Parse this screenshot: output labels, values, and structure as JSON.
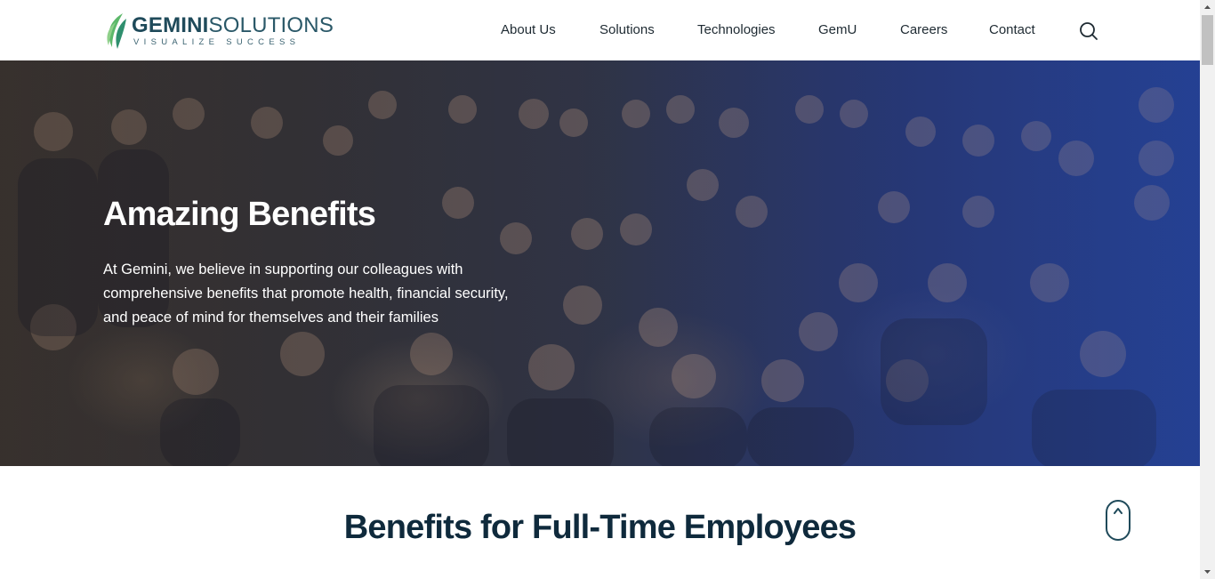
{
  "header": {
    "logo": {
      "brand_bold": "GEMINI",
      "brand_light": "SOLUTIONS",
      "tagline": "VISUALIZE SUCCESS"
    },
    "nav": [
      {
        "label": "About Us"
      },
      {
        "label": "Solutions"
      },
      {
        "label": "Technologies"
      },
      {
        "label": "GemU"
      },
      {
        "label": "Careers"
      },
      {
        "label": "Contact"
      }
    ],
    "search_icon": "search-icon"
  },
  "hero": {
    "title": "Amazing Benefits",
    "text": "At Gemini, we believe in supporting our colleagues with comprehensive benefits that promote health, financial security, and peace of mind for themselves and their families",
    "image": "group-photo-of-employees"
  },
  "section": {
    "title": "Benefits for Full-Time Employees"
  },
  "scroll_button": {
    "icon": "chevron-up-icon"
  },
  "colors": {
    "brand": "#1f4a5a",
    "logo_green": "#5cb86a",
    "heading": "#0f2a3c",
    "hero_tint": "#2a4490"
  }
}
